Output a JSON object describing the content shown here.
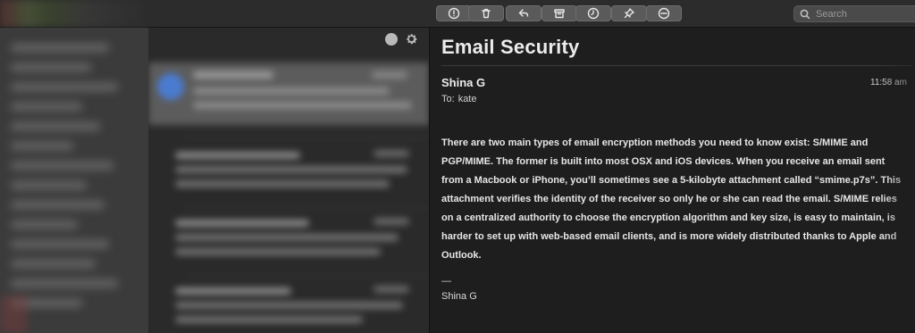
{
  "toolbar": {
    "buttons": [
      {
        "name": "flag",
        "icon": "exclamation-circle-icon"
      },
      {
        "name": "delete",
        "icon": "trash-icon"
      },
      {
        "name": "reply",
        "icon": "reply-icon"
      },
      {
        "name": "archive",
        "icon": "archive-box-icon"
      },
      {
        "name": "snooze",
        "icon": "clock-icon"
      },
      {
        "name": "pin",
        "icon": "pin-icon"
      },
      {
        "name": "more",
        "icon": "ellipsis-circle-icon"
      }
    ],
    "search_placeholder": "Search"
  },
  "message_list": {
    "header_icons": [
      "status-dot-icon",
      "gear-icon"
    ]
  },
  "email": {
    "subject": "Email Security",
    "sender": "Shina G",
    "time": "11:58 am",
    "to_label": "To:",
    "to_value": "kate",
    "body": "There are two main types of email encryption methods you need to know exist: S/MIME and PGP/MIME. The former is built into most OSX and iOS devices. When you receive an email sent from a Macbook or iPhone, you’ll sometimes see a 5-kilobyte attachment called “smime.p7s”. This attachment verifies the identity of the receiver so only he or she can read the email. S/MIME relies on a centralized authority to choose the encryption algorithm and key size, is easy to maintain, is harder to set up with web-based email clients, and is more widely distributed thanks to Apple and Outlook.",
    "signature_dash": "—",
    "signature_name": "Shina G"
  },
  "colors": {
    "background": "#1e1e1e",
    "toolbar": "#2c2c2c",
    "button": "#5a5a5a",
    "selected_row": "#5c5c5c",
    "avatar": "#4a7bd0",
    "text": "#e8e8e8"
  }
}
